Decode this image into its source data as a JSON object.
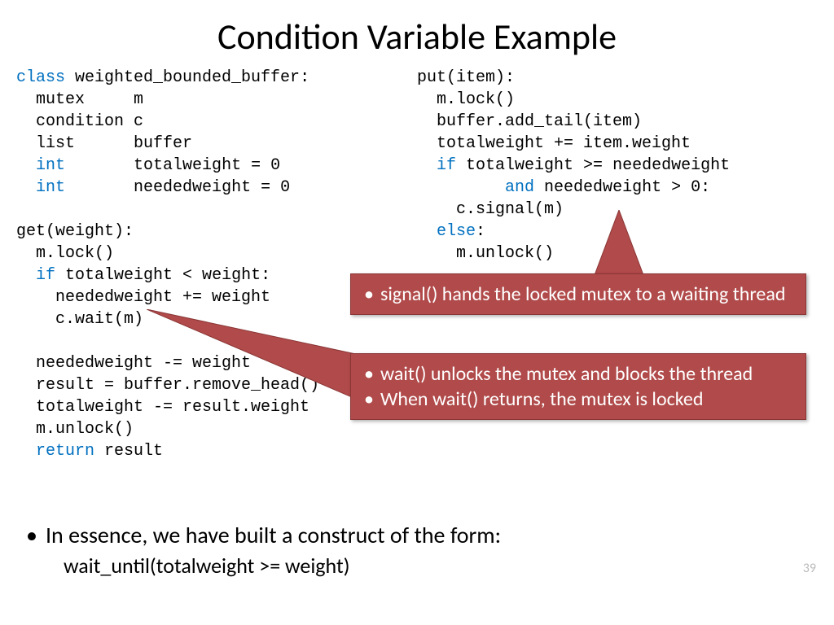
{
  "title": "Condition Variable Example",
  "code_left": {
    "l1a": "class",
    "l1b": " weighted_bounded_buffer:",
    "l2": "  mutex     m",
    "l3": "  condition c",
    "l4": "  list      buffer",
    "l5a": "  ",
    "l5b": "int",
    "l5c": "       totalweight = 0",
    "l6a": "  ",
    "l6b": "int",
    "l6c": "       neededweight = 0",
    "blank1": " ",
    "l7": "get(weight):",
    "l8": "  m.lock()",
    "l9a": "  ",
    "l9b": "if",
    "l9c": " totalweight < weight:",
    "l10": "    neededweight += weight",
    "l11": "    c.wait(m)",
    "blank2": " ",
    "l12": "  neededweight -= weight",
    "l13": "  result = buffer.remove_head()",
    "l14": "  totalweight -= result.weight",
    "l15": "  m.unlock()",
    "l16a": "  ",
    "l16b": "return",
    "l16c": " result"
  },
  "code_right": {
    "r1": "put(item):",
    "r2": "  m.lock()",
    "r3": "  buffer.add_tail(item)",
    "r4": "  totalweight += item.weight",
    "r5a": "  ",
    "r5b": "if",
    "r5c": " totalweight >= neededweight",
    "r6a": "         ",
    "r6b": "and",
    "r6c": " neededweight > 0:",
    "r7": "    c.signal(m)",
    "r8a": "  ",
    "r8b": "else",
    "r8c": ":",
    "r9": "    m.unlock()"
  },
  "callout1": {
    "b1": "signal() hands the locked mutex to a waiting thread"
  },
  "callout2": {
    "b1": "wait() unlocks the mutex and blocks the thread",
    "b2": "When wait() returns, the mutex is locked"
  },
  "bottom": {
    "line1": "In essence, we have built a construct of the form:",
    "line2": "wait_until(totalweight >= weight)"
  },
  "pagenum": "39"
}
